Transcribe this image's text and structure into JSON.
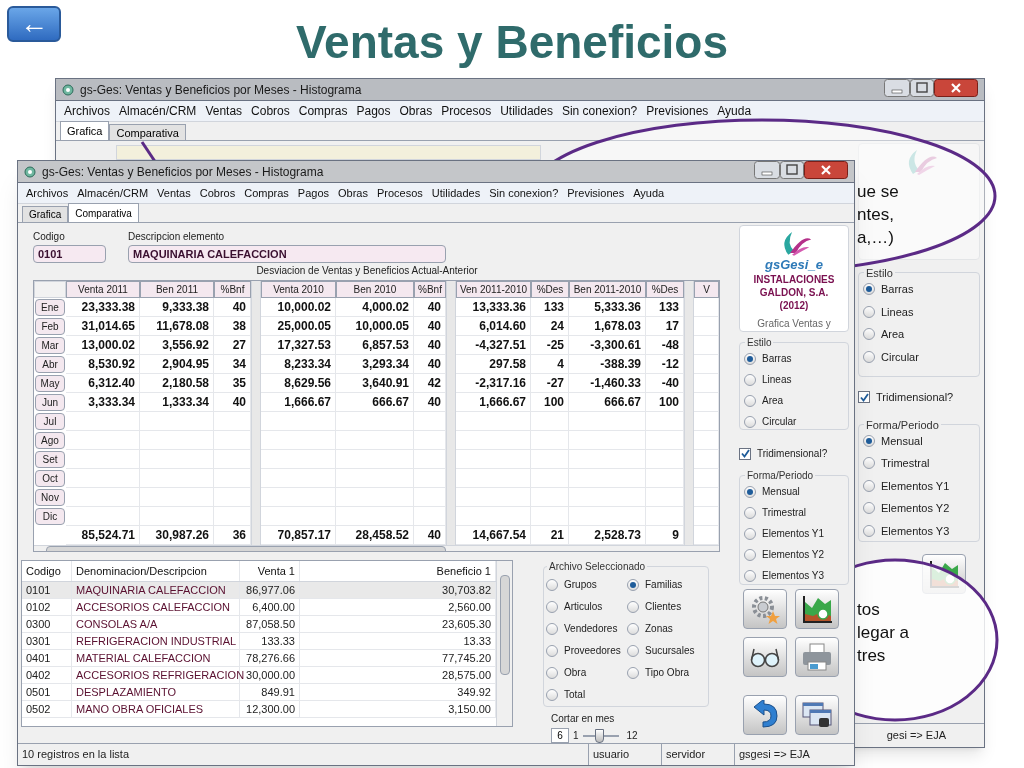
{
  "slide": {
    "title": "Ventas y Beneficios",
    "back_button": "←"
  },
  "back_window": {
    "title": "gs-Ges: Ventas y Beneficios por Meses - Histograma",
    "menu": [
      "Archivos",
      "Almacén/CRM",
      "Ventas",
      "Cobros",
      "Compras",
      "Pagos",
      "Obras",
      "Procesos",
      "Utilidades",
      "Sin conexion?",
      "Previsiones",
      "Ayuda"
    ],
    "tabs": [
      {
        "label": "Grafica",
        "selected": true
      },
      {
        "label": "Comparativa",
        "selected": false
      }
    ],
    "estilo": {
      "legend": "Estilo",
      "options": [
        {
          "label": "Barras",
          "selected": true
        },
        {
          "label": "Lineas",
          "selected": false
        },
        {
          "label": "Area",
          "selected": false
        },
        {
          "label": "Circular",
          "selected": false
        }
      ]
    },
    "tridimensional": {
      "label": "Tridimensional?",
      "checked": true
    },
    "forma": {
      "legend": "Forma/Periodo",
      "options": [
        {
          "label": "Mensual",
          "selected": true
        },
        {
          "label": "Trimestral",
          "selected": false
        },
        {
          "label": "Elementos Y1",
          "selected": false
        },
        {
          "label": "Elementos Y2",
          "selected": false
        },
        {
          "label": "Elementos Y3",
          "selected": false
        }
      ]
    },
    "status": "gesi => EJA"
  },
  "callouts": [
    {
      "lines": [
        "ue se",
        "ntes,",
        "a,…)"
      ]
    },
    {
      "lines": [
        "tos",
        "legar a",
        "tres"
      ]
    }
  ],
  "front_window": {
    "title": "gs-Ges: Ventas y Beneficios por Meses - Histograma",
    "menu": [
      "Archivos",
      "Almacén/CRM",
      "Ventas",
      "Cobros",
      "Compras",
      "Pagos",
      "Obras",
      "Procesos",
      "Utilidades",
      "Sin conexion?",
      "Previsiones",
      "Ayuda"
    ],
    "tabs": [
      {
        "label": "Grafica",
        "selected": false
      },
      {
        "label": "Comparativa",
        "selected": true
      }
    ],
    "codigo": {
      "label": "Codigo",
      "value": "0101"
    },
    "descripcion": {
      "label": "Descripcion elemento",
      "value": "MAQUINARIA CALEFACCION"
    },
    "table": {
      "caption": "Desviacion de Ventas y Beneficios Actual-Anterior",
      "columns": [
        "Venta 2011",
        "Ben 2011",
        "%Bnf",
        "Venta 2010",
        "Ben 2010",
        "%Bnf",
        "Ven 2011-2010",
        "%Des",
        "Ben 2011-2010",
        "%Des",
        "V"
      ],
      "rows": [
        {
          "month": "Ene",
          "values": [
            "23,333.38",
            "9,333.38",
            "40",
            "10,000.02",
            "4,000.02",
            "40",
            "13,333.36",
            "133",
            "5,333.36",
            "133"
          ]
        },
        {
          "month": "Feb",
          "values": [
            "31,014.65",
            "11,678.08",
            "38",
            "25,000.05",
            "10,000.05",
            "40",
            "6,014.60",
            "24",
            "1,678.03",
            "17"
          ]
        },
        {
          "month": "Mar",
          "values": [
            "13,000.02",
            "3,556.92",
            "27",
            "17,327.53",
            "6,857.53",
            "40",
            "-4,327.51",
            "-25",
            "-3,300.61",
            "-48"
          ]
        },
        {
          "month": "Abr",
          "values": [
            "8,530.92",
            "2,904.95",
            "34",
            "8,233.34",
            "3,293.34",
            "40",
            "297.58",
            "4",
            "-388.39",
            "-12"
          ]
        },
        {
          "month": "May",
          "values": [
            "6,312.40",
            "2,180.58",
            "35",
            "8,629.56",
            "3,640.91",
            "42",
            "-2,317.16",
            "-27",
            "-1,460.33",
            "-40"
          ]
        },
        {
          "month": "Jun",
          "values": [
            "3,333.34",
            "1,333.34",
            "40",
            "1,666.67",
            "666.67",
            "40",
            "1,666.67",
            "100",
            "666.67",
            "100"
          ]
        },
        {
          "month": "Jul"
        },
        {
          "month": "Ago"
        },
        {
          "month": "Set"
        },
        {
          "month": "Oct"
        },
        {
          "month": "Nov"
        },
        {
          "month": "Dic"
        }
      ],
      "totals": [
        "85,524.71",
        "30,987.26",
        "36",
        "70,857.17",
        "28,458.52",
        "40",
        "14,667.54",
        "21",
        "2,528.73",
        "9"
      ]
    },
    "list": {
      "columns": [
        "Codigo",
        "Denominacion/Descripcion",
        "Venta 1",
        "Beneficio 1"
      ],
      "rows": [
        {
          "cells": [
            "0101",
            "MAQUINARIA CALEFACCION",
            "86,977.06",
            "30,703.82"
          ],
          "selected": true
        },
        {
          "cells": [
            "0102",
            "ACCESORIOS CALEFACCION",
            "6,400.00",
            "2,560.00"
          ],
          "selected": false
        },
        {
          "cells": [
            "0300",
            "CONSOLAS A/A",
            "87,058.50",
            "23,605.30"
          ],
          "selected": false
        },
        {
          "cells": [
            "0301",
            "REFRIGERACION INDUSTRIAL",
            "133.33",
            "13.33"
          ],
          "selected": false
        },
        {
          "cells": [
            "0401",
            "MATERIAL CALEFACCION",
            "78,276.66",
            "77,745.20"
          ],
          "selected": false
        },
        {
          "cells": [
            "0402",
            "ACCESORIOS REFRIGERACION",
            "30,000.00",
            "28,575.00"
          ],
          "selected": false
        },
        {
          "cells": [
            "0501",
            "DESPLAZAMIENTO",
            "849.91",
            "349.92"
          ],
          "selected": false
        },
        {
          "cells": [
            "0502",
            "MANO OBRA OFICIALES",
            "12,300.00",
            "3,150.00"
          ],
          "selected": false
        }
      ]
    },
    "archivo": {
      "legend": "Archivo Seleccionado",
      "options": [
        {
          "label": "Grupos",
          "selected": false
        },
        {
          "label": "Familias",
          "selected": true
        },
        {
          "label": "Articulos",
          "selected": false
        },
        {
          "label": "Clientes",
          "selected": false
        },
        {
          "label": "Vendedores",
          "selected": false
        },
        {
          "label": "Zonas",
          "selected": false
        },
        {
          "label": "Proveedores",
          "selected": false
        },
        {
          "label": "Sucursales",
          "selected": false
        },
        {
          "label": "Obra",
          "selected": false
        },
        {
          "label": "Tipo Obra",
          "selected": false
        },
        {
          "label": "Total",
          "selected": false
        }
      ]
    },
    "cortar": {
      "label": "Cortar en mes",
      "value": "6",
      "min": "1",
      "max": "12",
      "level": 0.45
    },
    "logo": {
      "brand": "gsGesi_e",
      "company": [
        "INSTALACIONES",
        "GALDON, S.A.",
        "(2012)"
      ],
      "caption": "Grafica Ventas y"
    },
    "estilo": {
      "legend": "Estilo",
      "options": [
        {
          "label": "Barras",
          "selected": true
        },
        {
          "label": "Lineas",
          "selected": false
        },
        {
          "label": "Area",
          "selected": false
        },
        {
          "label": "Circular",
          "selected": false
        }
      ]
    },
    "tridimensional": {
      "label": "Tridimensional?",
      "checked": true
    },
    "forma": {
      "legend": "Forma/Periodo",
      "options": [
        {
          "label": "Mensual",
          "selected": true
        },
        {
          "label": "Trimestral",
          "selected": false
        },
        {
          "label": "Elementos Y1",
          "selected": false
        },
        {
          "label": "Elementos Y2",
          "selected": false
        },
        {
          "label": "Elementos Y3",
          "selected": false
        }
      ]
    },
    "status": [
      "10 registros en la lista",
      "usuario",
      "servidor",
      "gsgesi => EJA"
    ]
  }
}
